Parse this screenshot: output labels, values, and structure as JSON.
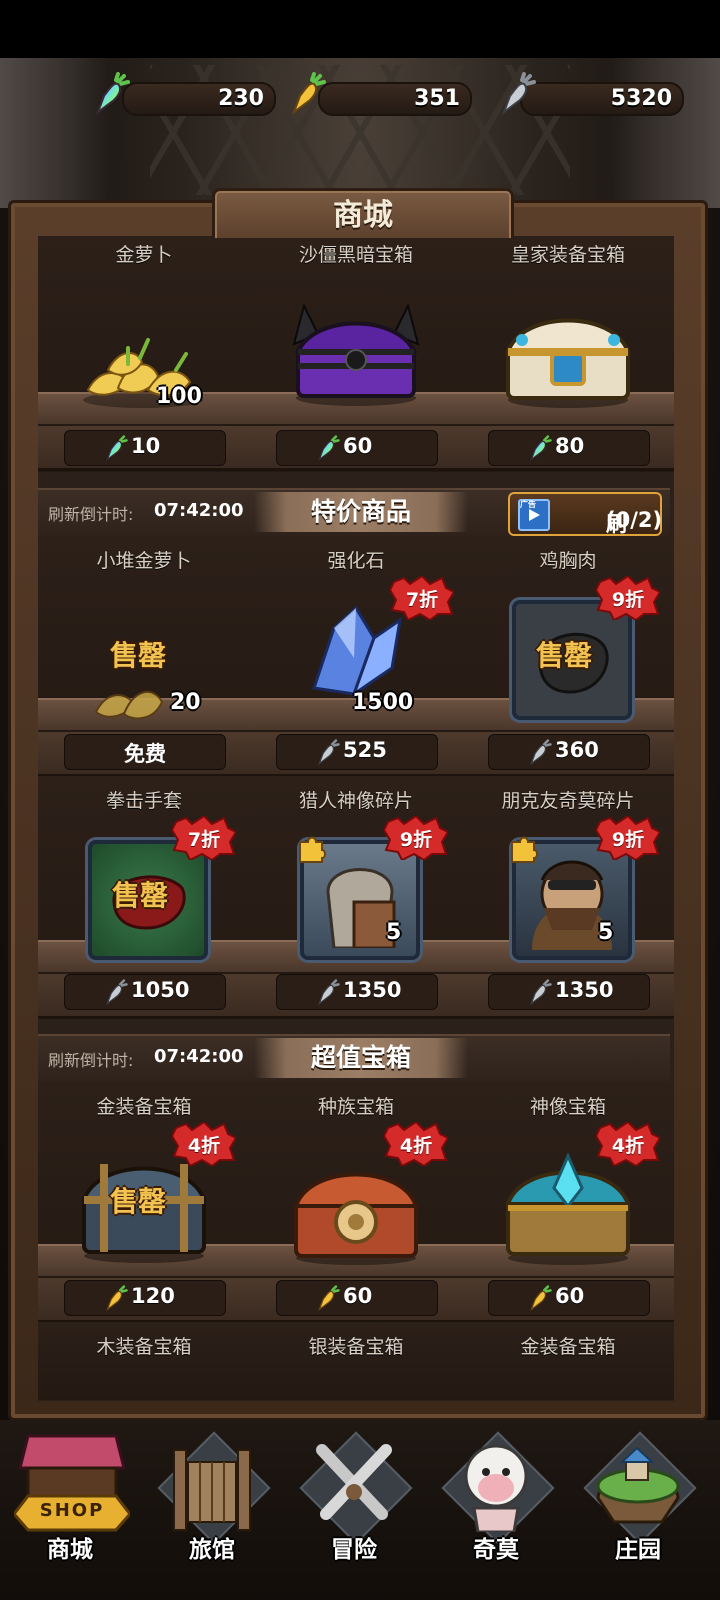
{
  "currencies": [
    {
      "icon": "rainbow-carrot-icon",
      "value": "230"
    },
    {
      "icon": "gold-carrot-icon",
      "value": "351"
    },
    {
      "icon": "silver-carrot-icon",
      "value": "5320"
    }
  ],
  "title": "商城",
  "top_row": [
    {
      "name": "金萝卜",
      "qty": "100",
      "price": "10",
      "currency": "rainbow-carrot-icon"
    },
    {
      "name": "沙僵黑暗宝箱",
      "price": "60",
      "currency": "rainbow-carrot-icon"
    },
    {
      "name": "皇家装备宝箱",
      "price": "80",
      "currency": "rainbow-carrot-icon"
    }
  ],
  "special": {
    "countdown_label": "刷新倒计时:",
    "countdown": "07:42:00",
    "title": "特价商品",
    "refresh_ad": "广告",
    "refresh_label": "刷新",
    "refresh_count": "(0/2)",
    "rows": [
      [
        {
          "name": "小堆金萝卜",
          "qty": "20",
          "sold": "售罄",
          "price_text": "免费"
        },
        {
          "name": "强化石",
          "qty": "1500",
          "discount": "7折",
          "price": "525",
          "currency": "silver-carrot-icon"
        },
        {
          "name": "鸡胸肉",
          "sold": "售罄",
          "discount": "9折",
          "price": "360",
          "currency": "silver-carrot-icon"
        }
      ],
      [
        {
          "name": "拳击手套",
          "sold": "售罄",
          "discount": "7折",
          "price": "1050",
          "currency": "silver-carrot-icon"
        },
        {
          "name": "猎人神像碎片",
          "qty": "5",
          "discount": "9折",
          "price": "1350",
          "currency": "silver-carrot-icon"
        },
        {
          "name": "朋克友奇莫碎片",
          "qty": "5",
          "discount": "9折",
          "price": "1350",
          "currency": "silver-carrot-icon"
        }
      ]
    ]
  },
  "chests": {
    "countdown_label": "刷新倒计时:",
    "countdown": "07:42:00",
    "title": "超值宝箱",
    "row": [
      {
        "name": "金装备宝箱",
        "sold": "售罄",
        "discount": "4折",
        "price": "120",
        "currency": "gold-carrot-icon"
      },
      {
        "name": "种族宝箱",
        "discount": "4折",
        "price": "60",
        "currency": "gold-carrot-icon"
      },
      {
        "name": "神像宝箱",
        "discount": "4折",
        "price": "60",
        "currency": "gold-carrot-icon"
      }
    ],
    "next_row": [
      "木装备宝箱",
      "银装备宝箱",
      "金装备宝箱"
    ]
  },
  "nav": [
    {
      "label": "商城",
      "sign": "SHOP",
      "icon": "shop-icon",
      "active": true
    },
    {
      "label": "旅馆",
      "icon": "inn-gate-icon"
    },
    {
      "label": "冒险",
      "icon": "crossed-swords-icon"
    },
    {
      "label": "奇莫",
      "icon": "kimo-character-icon"
    },
    {
      "label": "庄园",
      "icon": "manor-island-icon"
    }
  ]
}
